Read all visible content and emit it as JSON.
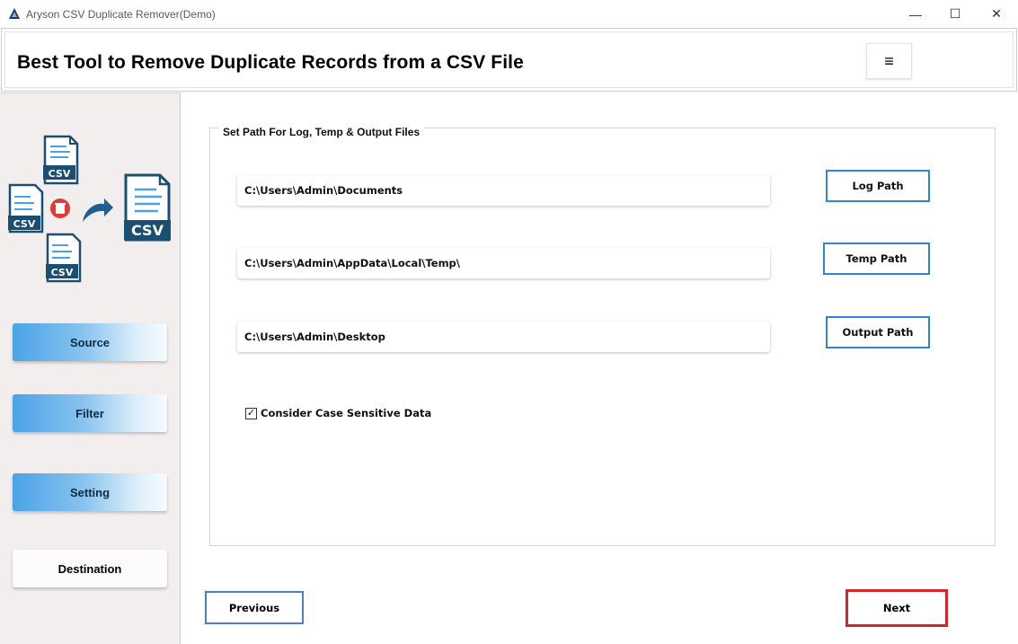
{
  "window": {
    "title": "Aryson CSV Duplicate Remover(Demo)",
    "minimize_glyph": "—",
    "maximize_glyph": "☐",
    "close_glyph": "✕"
  },
  "header": {
    "title": "Best Tool to Remove Duplicate Records from a CSV File",
    "menu_glyph": "≡"
  },
  "sidebar": {
    "illustration_label": "CSV",
    "items": [
      {
        "label": "Source",
        "active": true
      },
      {
        "label": "Filter",
        "active": true
      },
      {
        "label": "Setting",
        "active": true
      },
      {
        "label": "Destination",
        "active": false
      }
    ]
  },
  "main": {
    "group_title": "Set Path For Log, Temp & Output Files",
    "paths": [
      {
        "value": "C:\\Users\\Admin\\Documents",
        "button": "Log Path"
      },
      {
        "value": "C:\\Users\\Admin\\AppData\\Local\\Temp\\",
        "button": "Temp Path"
      },
      {
        "value": "C:\\Users\\Admin\\Desktop",
        "button": "Output Path"
      }
    ],
    "case_sensitive": {
      "label": "Consider Case Sensitive Data",
      "checked": true,
      "check_glyph": "✓"
    }
  },
  "footer": {
    "previous_label": "Previous",
    "next_label": "Next"
  },
  "colors": {
    "accent_blue": "#2f86d6",
    "highlight_red": "#d8232a",
    "sidebar_bg": "#f3eeee",
    "icon_navy": "#1b4f72"
  }
}
